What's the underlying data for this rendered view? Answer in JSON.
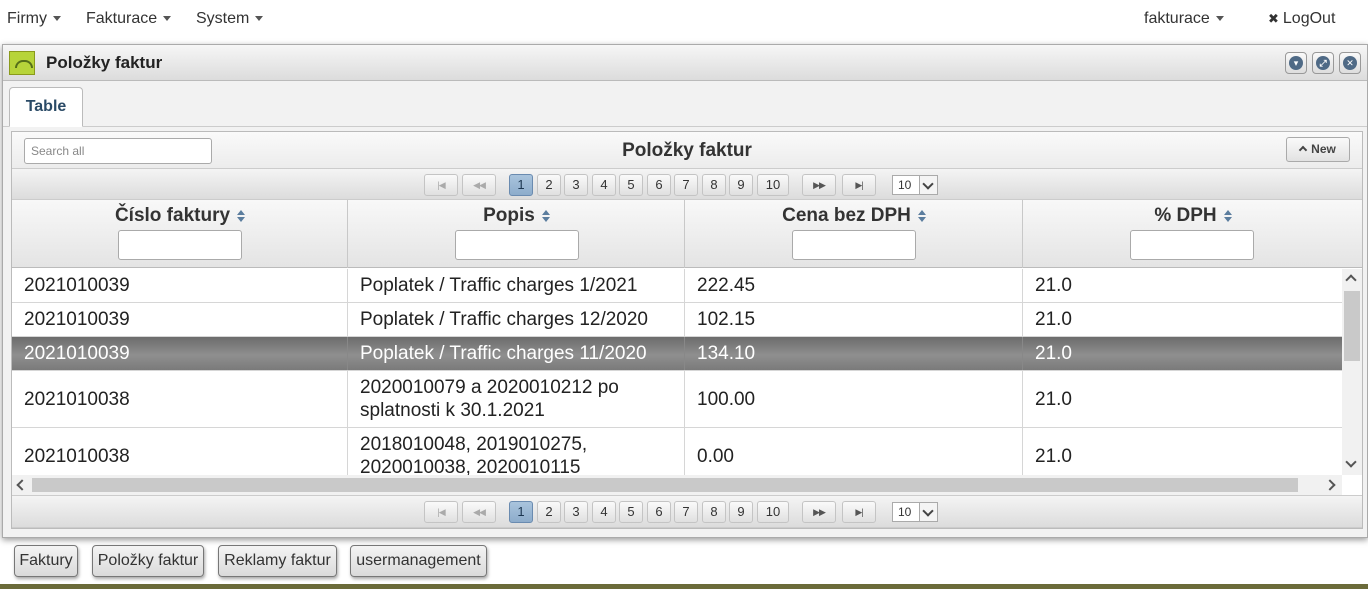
{
  "topmenu": {
    "firmy": "Firmy",
    "fakturace": "Fakturace",
    "system": "System",
    "user": "fakturace",
    "logout": "LogOut"
  },
  "window": {
    "title": "Položky faktur",
    "tab": "Table"
  },
  "table": {
    "caption": "Položky faktur",
    "search_placeholder": "Search all",
    "new_label": "New",
    "pages": [
      "1",
      "2",
      "3",
      "4",
      "5",
      "6",
      "7",
      "8",
      "9",
      "10"
    ],
    "current_page": "1",
    "rows_per_page": "10",
    "columns": [
      "Číslo faktury",
      "Popis",
      "Cena bez DPH",
      "% DPH"
    ],
    "rows": [
      {
        "cislo": "2021010039",
        "popis": "Poplatek / Traffic charges 1/2021",
        "cena": "222.45",
        "dph": "21.0"
      },
      {
        "cislo": "2021010039",
        "popis": "Poplatek / Traffic charges 12/2020",
        "cena": "102.15",
        "dph": "21.0"
      },
      {
        "cislo": "2021010039",
        "popis": "Poplatek / Traffic charges 11/2020",
        "cena": "134.10",
        "dph": "21.0"
      },
      {
        "cislo": "2021010038",
        "popis": "2020010079 a 2020010212 po splatnosti k 30.1.2021",
        "cena": "100.00",
        "dph": "21.0"
      },
      {
        "cislo": "2021010038",
        "popis": "2018010048, 2019010275, 2020010038, 2020010115",
        "cena": "0.00",
        "dph": "21.0"
      }
    ]
  },
  "taskbar": [
    "Faktury",
    "Položky faktur",
    "Reklamy faktur",
    "usermanagement"
  ]
}
